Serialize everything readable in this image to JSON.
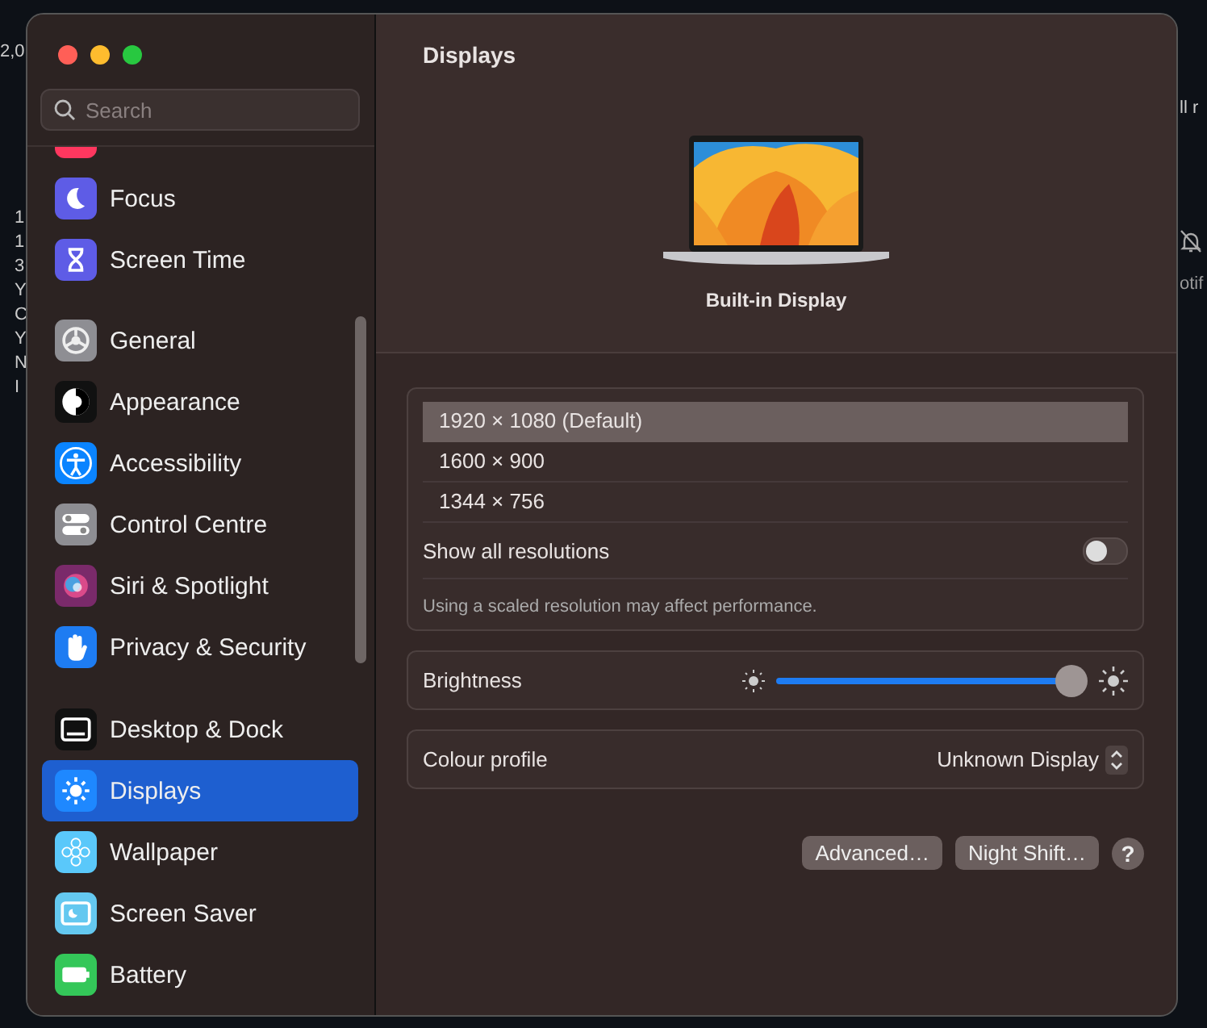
{
  "background": {
    "left_fragments": [
      "2,0"
    ],
    "left_column": [
      "1",
      "1",
      "3",
      "Y",
      "C",
      "Y",
      "N",
      "I"
    ],
    "right_fragments": [
      "ll r",
      "otif"
    ]
  },
  "sidebar": {
    "search": {
      "placeholder": "Search"
    },
    "groups": [
      {
        "items": [
          {
            "label": "Focus",
            "color": "#5e5ce6",
            "selected": false
          },
          {
            "label": "Screen Time",
            "color": "#5e5ce6",
            "selected": false
          }
        ]
      },
      {
        "items": [
          {
            "label": "General",
            "color": "#8e8e93",
            "selected": false
          },
          {
            "label": "Appearance",
            "color": "#111111",
            "selected": false
          },
          {
            "label": "Accessibility",
            "color": "#0a84ff",
            "selected": false
          },
          {
            "label": "Control Centre",
            "color": "#8e8e93",
            "selected": false
          },
          {
            "label": "Siri & Spotlight",
            "color": "#7a2a6a",
            "selected": false
          },
          {
            "label": "Privacy & Security",
            "color": "#1e7cf2",
            "selected": false
          }
        ]
      },
      {
        "items": [
          {
            "label": "Desktop & Dock",
            "color": "#111111",
            "selected": false
          },
          {
            "label": "Displays",
            "color": "#1e88ff",
            "selected": true
          },
          {
            "label": "Wallpaper",
            "color": "#5ac8fa",
            "selected": false
          },
          {
            "label": "Screen Saver",
            "color": "#64c8f0",
            "selected": false
          },
          {
            "label": "Battery",
            "color": "#34c759",
            "selected": false
          }
        ]
      }
    ]
  },
  "main": {
    "title": "Displays",
    "display_name": "Built-in Display",
    "resolutions": [
      {
        "label": "1920 × 1080 (Default)",
        "selected": true
      },
      {
        "label": "1600 × 900",
        "selected": false
      },
      {
        "label": "1344 × 756",
        "selected": false
      }
    ],
    "show_all": {
      "label": "Show all resolutions",
      "on": false
    },
    "note": "Using a scaled resolution may affect performance.",
    "brightness": {
      "label": "Brightness",
      "level": 0.95
    },
    "colour_profile": {
      "label": "Colour profile",
      "value": "Unknown Display"
    },
    "buttons": [
      "Advanced…",
      "Night Shift…"
    ],
    "help": "?"
  }
}
